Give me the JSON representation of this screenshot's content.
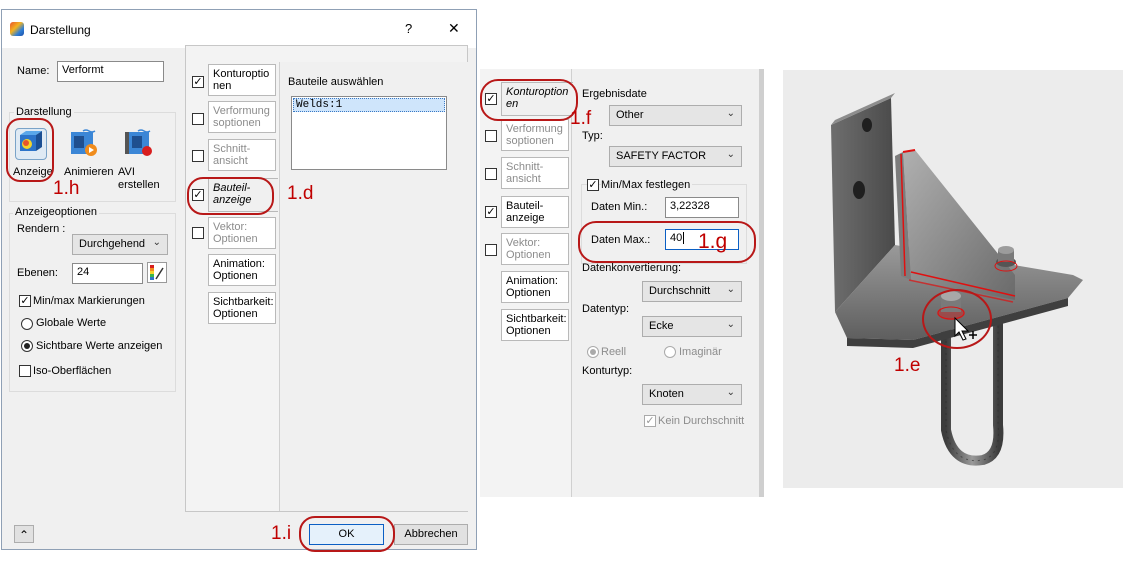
{
  "dialog": {
    "title": "Darstellung",
    "help": "?",
    "close": "✕",
    "name_label": "Name:",
    "name_value": "Verformt",
    "darstellung_group": "Darstellung",
    "anzeige_label": "Anzeige",
    "animieren_label": "Animieren",
    "avi_label": "AVI erstellen",
    "avi_line1": "AVI",
    "avi_line2": "erstellen",
    "anzeigeoptionen_group": "Anzeigeoptionen",
    "rendern_label": "Rendern :",
    "rendern_value": "Durchgehend",
    "ebenen_label": "Ebenen:",
    "ebenen_value": "24",
    "minmax_label": "Min/max Markierungen",
    "globale_label": "Globale Werte",
    "sichtbare_label": "Sichtbare Werte anzeigen",
    "iso_label": "Iso-Oberflächen",
    "expand_icon": "⌃",
    "ok_label": "OK",
    "cancel_label": "Abbrechen",
    "tabs": [
      {
        "line1": "Konturoptio",
        "line2": "nen"
      },
      {
        "line1": "Verformung",
        "line2": "soptionen"
      },
      {
        "line1": "Schnitt-",
        "line2": "ansicht"
      },
      {
        "line1": "Bauteil-",
        "line2": "anzeige"
      },
      {
        "line1": "Vektor:",
        "line2": "Optionen"
      },
      {
        "line1": "Animation:",
        "line2": "Optionen"
      },
      {
        "line1": "Sichtbarkeit:",
        "line2": "Optionen"
      }
    ],
    "bauteile_title": "Bauteile auswählen",
    "bauteile_item": "Welds:1"
  },
  "panel2": {
    "tabs": [
      {
        "line1": "Konturoption",
        "line2": "en"
      },
      {
        "line1": "Verformung",
        "line2": "soptionen"
      },
      {
        "line1": "Schnitt-",
        "line2": "ansicht"
      },
      {
        "line1": "Bauteil-",
        "line2": "anzeige"
      },
      {
        "line1": "Vektor:",
        "line2": "Optionen"
      },
      {
        "line1": "Animation:",
        "line2": "Optionen"
      },
      {
        "line1": "Sichtbarkeit:",
        "line2": "Optionen"
      }
    ],
    "ergebnisdaten_label": "Ergebnisdate",
    "ergebnisdaten_value": "Other",
    "typ_label": "Typ:",
    "typ_value": "SAFETY FACTOR",
    "minmax_festlegen": "Min/Max festlegen",
    "daten_min_label": "Daten Min.:",
    "daten_min_value": "3,22328",
    "daten_max_label": "Daten Max.:",
    "daten_max_value": "40",
    "datenkonvertierung_label": "Datenkonvertierung:",
    "datenkonvertierung_value": "Durchschnitt",
    "datentyp_label": "Datentyp:",
    "datentyp_value": "Ecke",
    "reell_label": "Reell",
    "imaginaer_label": "Imaginär",
    "konturtyp_label": "Konturtyp:",
    "konturtyp_value": "Knoten",
    "kein_durchschnitt": "Kein Durchschnitt"
  },
  "annotations": {
    "h": "1.h",
    "d": "1.d",
    "i": "1.i",
    "f": "1.f",
    "g": "1.g",
    "e": "1.e"
  },
  "icons": {
    "check": "✓",
    "chevron": "⌄"
  }
}
